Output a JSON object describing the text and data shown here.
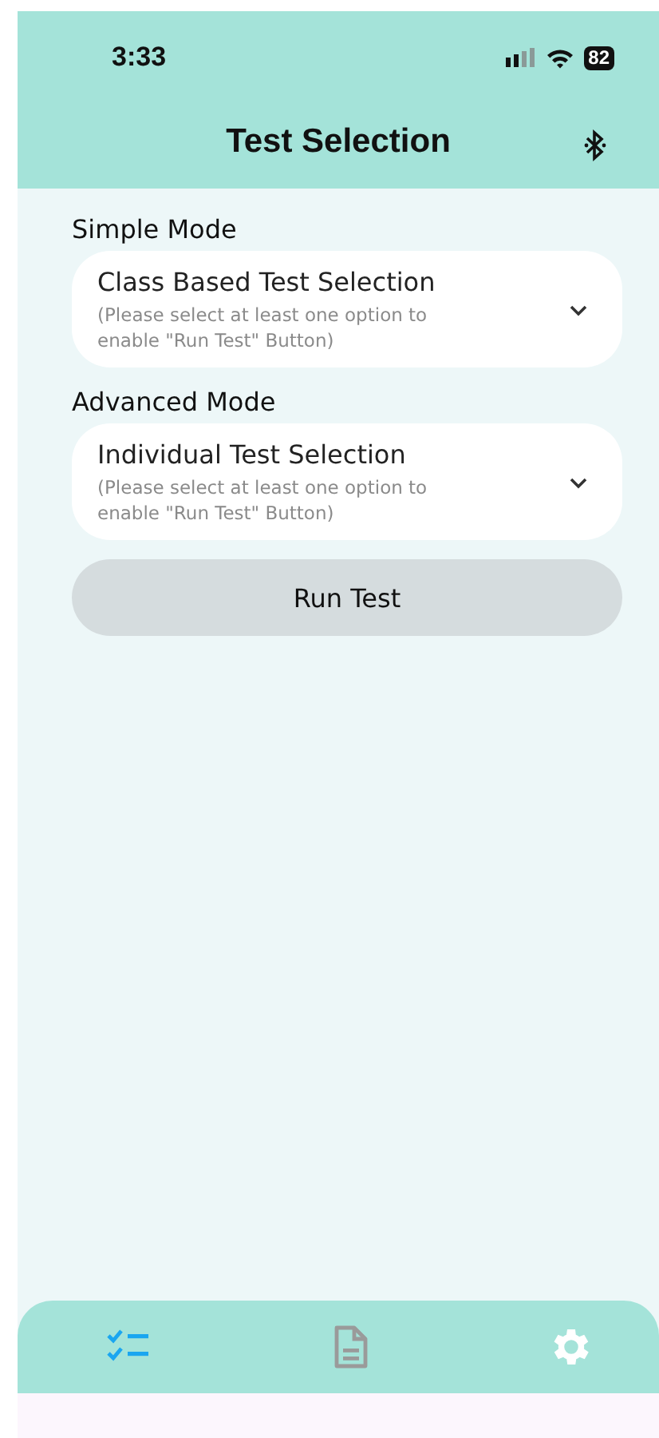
{
  "status_bar": {
    "time": "3:33",
    "battery": "82"
  },
  "header": {
    "title": "Test Selection"
  },
  "sections": [
    {
      "label": "Simple Mode",
      "dropdown": {
        "title": "Class Based Test Selection",
        "hint": "(Please select at least one option to enable \"Run Test\" Button)"
      }
    },
    {
      "label": "Advanced Mode",
      "dropdown": {
        "title": "Individual Test Selection",
        "hint": "(Please select at least one option to enable \"Run Test\" Button)"
      }
    }
  ],
  "run_button": {
    "label": "Run Test",
    "disabled": true
  },
  "tabs": [
    {
      "kind": "checklist",
      "color": "#1aa6f0"
    },
    {
      "kind": "document",
      "color": "#9a9a9a"
    },
    {
      "kind": "settings",
      "color": "#ffffff"
    }
  ]
}
